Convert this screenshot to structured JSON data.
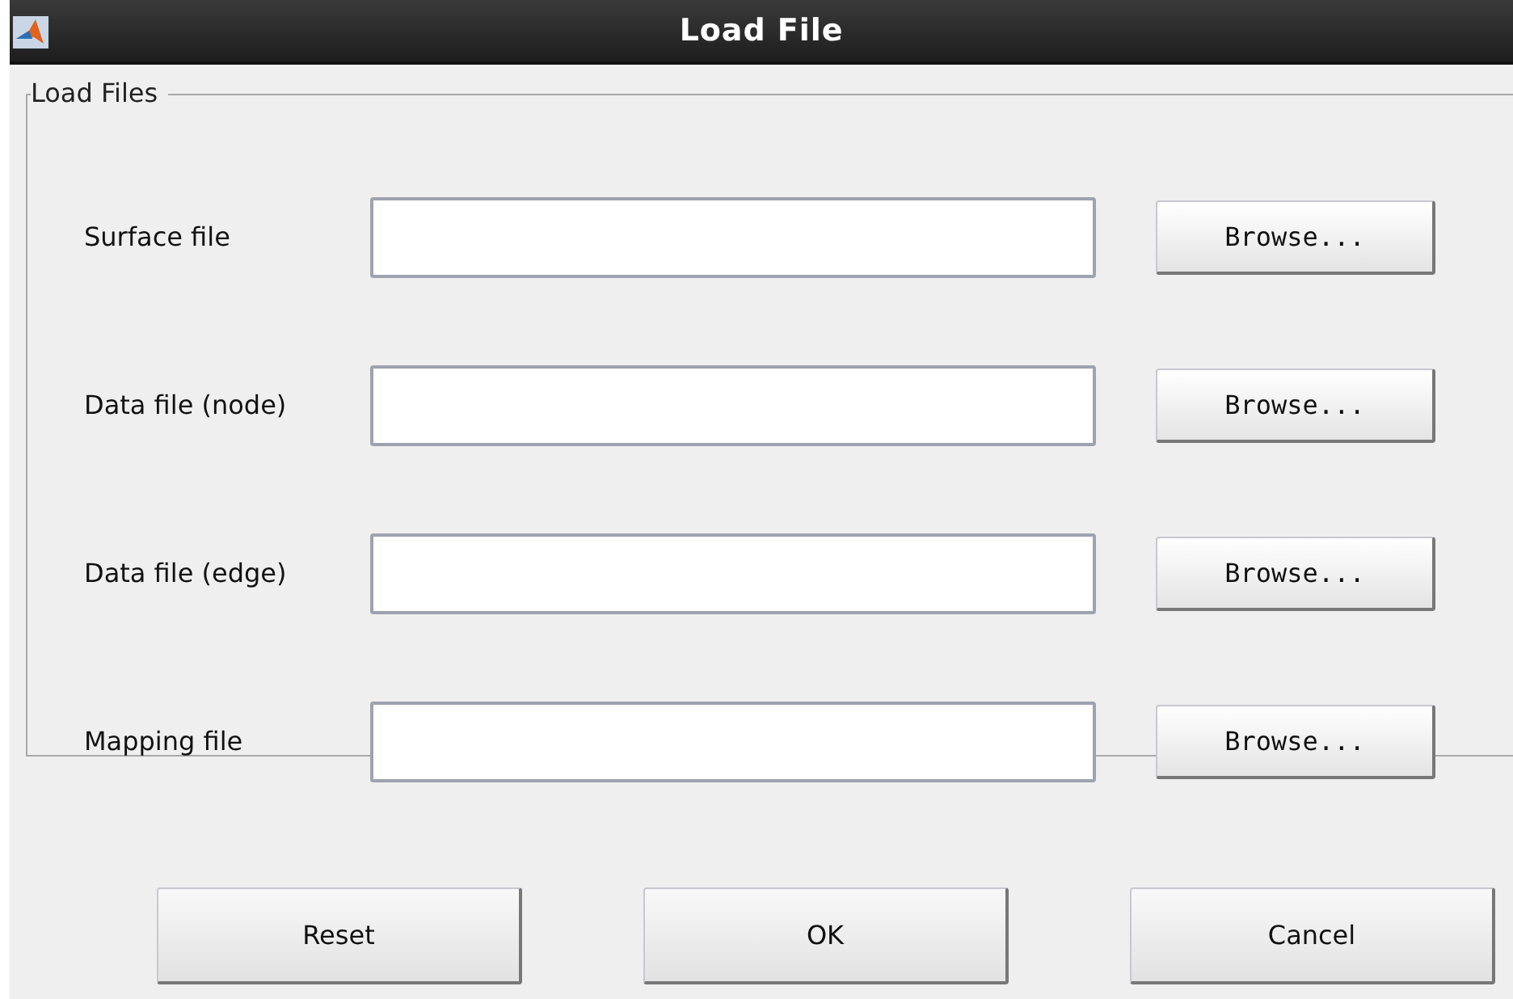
{
  "window": {
    "title": "Load File"
  },
  "group": {
    "title": "Load Files"
  },
  "rows": [
    {
      "label": "Surface file",
      "button": "Browse..."
    },
    {
      "label": "Data file (node)",
      "button": "Browse..."
    },
    {
      "label": "Data file (edge)",
      "button": "Browse..."
    },
    {
      "label": "Mapping file",
      "button": "Browse..."
    }
  ],
  "buttons": [
    "Reset",
    "OK",
    "Cancel"
  ]
}
